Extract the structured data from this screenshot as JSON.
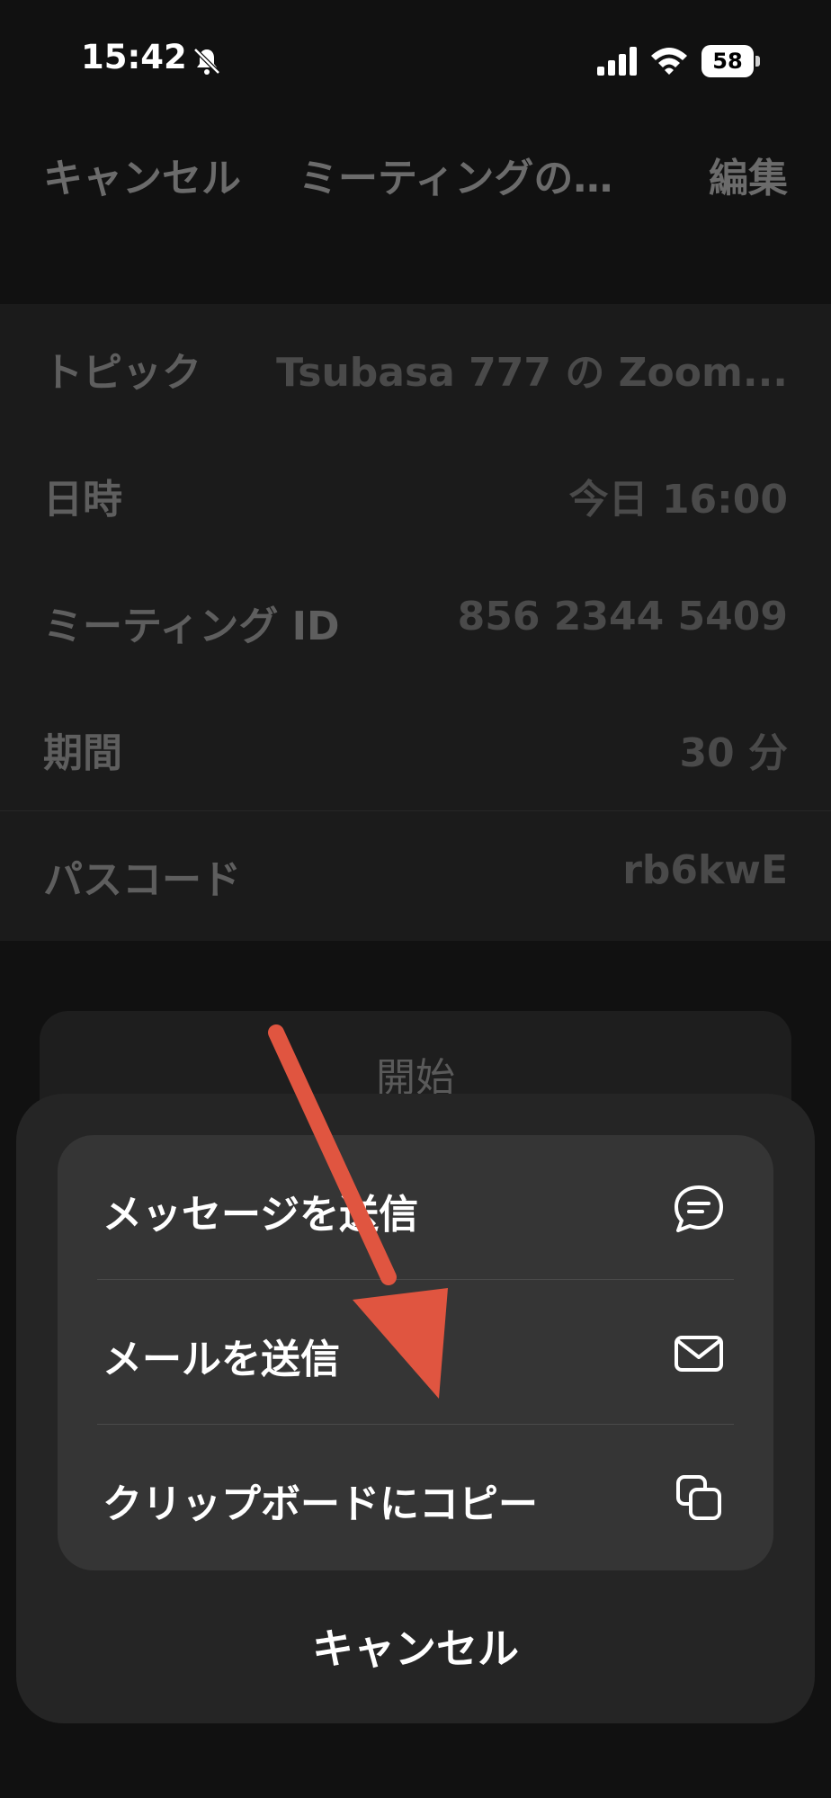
{
  "status_bar": {
    "time": "15:42",
    "battery": "58",
    "icons": [
      "bell-off-icon",
      "signal-icon",
      "wifi-icon",
      "battery-icon"
    ]
  },
  "nav": {
    "cancel_label": "キャンセル",
    "title": "ミーティングの…",
    "edit_label": "編集"
  },
  "details": {
    "rows": [
      {
        "label": "トピック",
        "value": "Tsubasa 777 の Zoom..."
      },
      {
        "label": "日時",
        "value": "今日 16:00"
      },
      {
        "label": "ミーティング ID",
        "value": "856 2344 5409"
      },
      {
        "label": "期間",
        "value": "30 分"
      },
      {
        "label": "パスコード",
        "value": "rb6kwE"
      }
    ]
  },
  "start_button": {
    "label": "開始"
  },
  "action_sheet": {
    "options": [
      {
        "label": "メッセージを送信",
        "icon": "message-bubble-icon"
      },
      {
        "label": "メールを送信",
        "icon": "envelope-icon"
      },
      {
        "label": "クリップボードにコピー",
        "icon": "copy-icon"
      }
    ],
    "cancel_label": "キャンセル"
  },
  "annotation": {
    "color": "#e05540",
    "icon": "arrow-icon"
  }
}
